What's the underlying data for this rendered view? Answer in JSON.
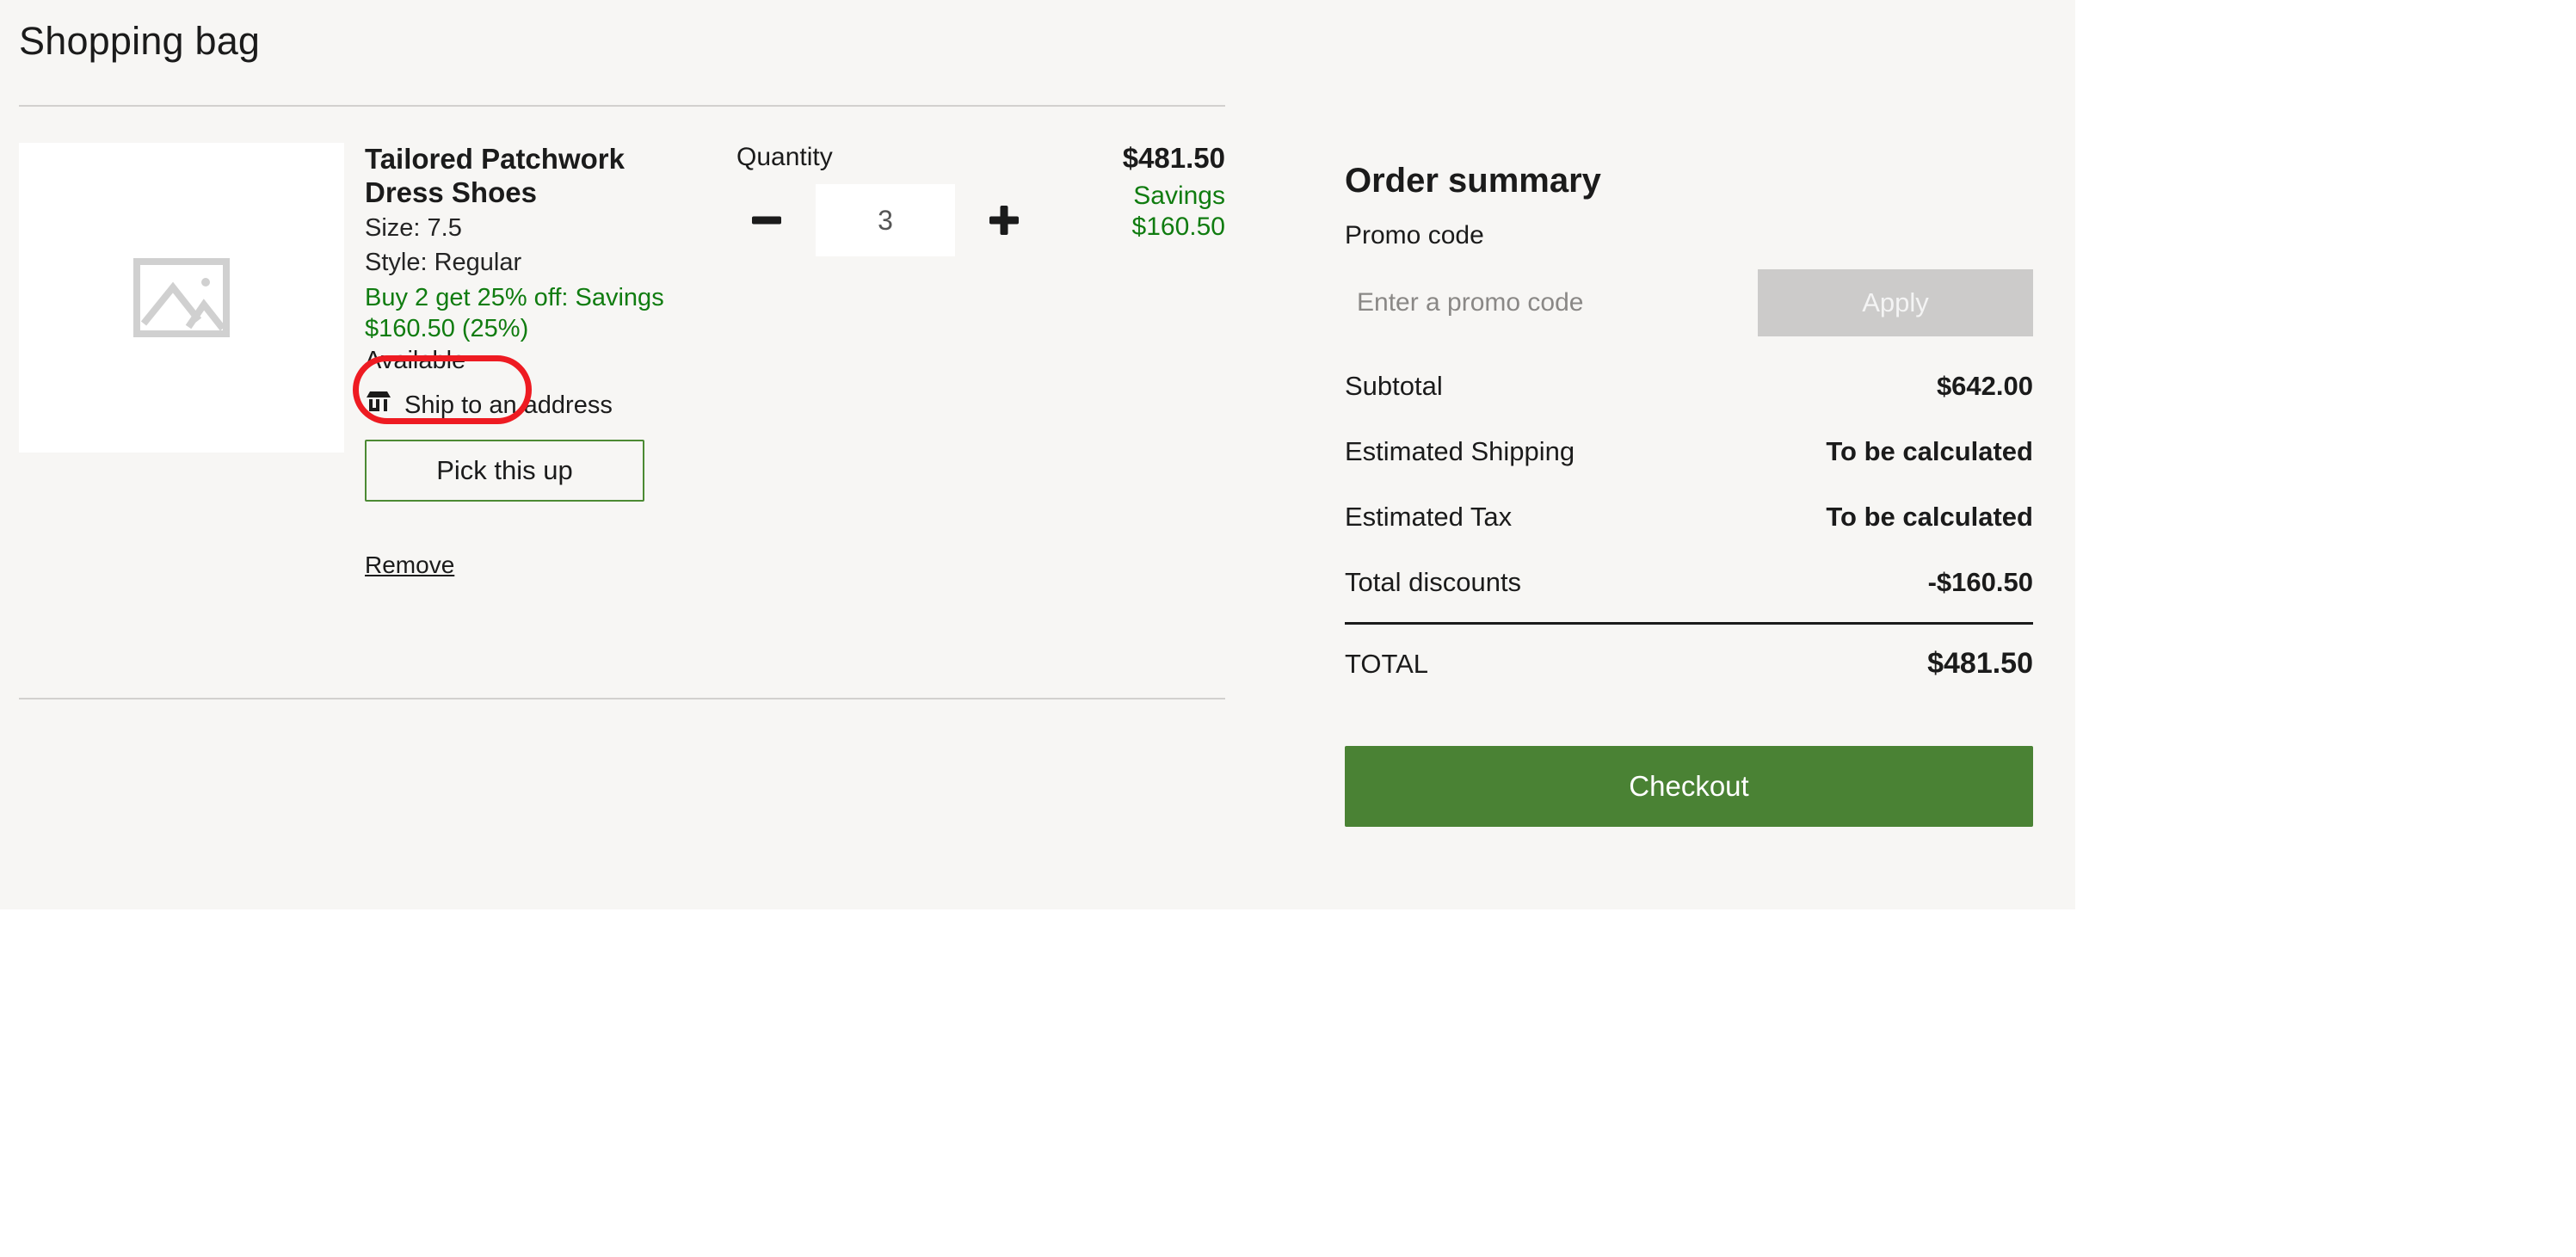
{
  "page": {
    "title": "Shopping bag"
  },
  "line_item": {
    "thumbnail_icon": "image-placeholder-icon",
    "product_name": "Tailored Patchwork Dress Shoes",
    "attributes": [
      "Size: 7.5",
      "Style: Regular"
    ],
    "promotion_text": "Buy 2 get 25% off: Savings $160.50 (25%)",
    "availability": "Available",
    "fulfillment": {
      "icon": "store-icon",
      "label": "Ship to an address",
      "alternate_button": "Pick this up"
    },
    "remove_label": "Remove",
    "quantity": {
      "label": "Quantity",
      "value": "3",
      "decrease_icon": "minus-icon",
      "increase_icon": "plus-icon"
    },
    "price": "$481.50",
    "savings_label": "Savings",
    "savings_amount": "$160.50"
  },
  "order_summary": {
    "title": "Order summary",
    "promo_code_label": "Promo code",
    "promo_placeholder": "Enter a promo code",
    "promo_value": "",
    "apply_label": "Apply",
    "rows": [
      {
        "label": "Subtotal",
        "value": "$642.00"
      },
      {
        "label": "Estimated Shipping",
        "value": "To be calculated"
      },
      {
        "label": "Estimated Tax",
        "value": "To be calculated"
      },
      {
        "label": "Total discounts",
        "value": "-$160.50"
      }
    ],
    "total_label": "TOTAL",
    "total_value": "$481.50",
    "checkout_label": "Checkout"
  },
  "colors": {
    "app_background": "#f7f6f4",
    "accent_green": "#4a8234",
    "savings_green": "#107c10",
    "annotation_red": "#ee1b22",
    "apply_disabled": "#cccbca"
  }
}
